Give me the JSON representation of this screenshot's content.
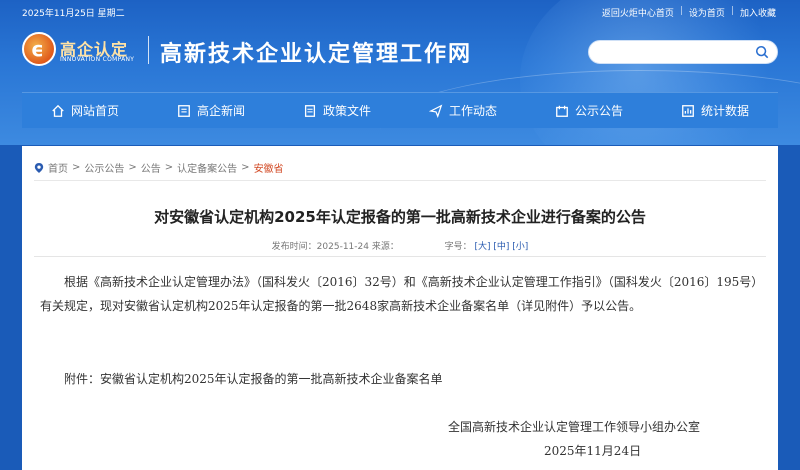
{
  "header": {
    "date": "2025年11月25日 星期二",
    "links": [
      "返回火炬中心首页",
      "设为首页",
      "加入收藏"
    ],
    "logo_cn": "高企认定",
    "logo_en": "INNOVATION COMPANY",
    "site_title": "高新技术企业认定管理工作网",
    "search_placeholder": ""
  },
  "nav": {
    "items": [
      {
        "label": "网站首页",
        "icon": "home-icon"
      },
      {
        "label": "高企新闻",
        "icon": "news-icon"
      },
      {
        "label": "政策文件",
        "icon": "document-icon"
      },
      {
        "label": "工作动态",
        "icon": "send-icon"
      },
      {
        "label": "公示公告",
        "icon": "notice-icon"
      },
      {
        "label": "统计数据",
        "icon": "chart-icon"
      }
    ]
  },
  "breadcrumb": {
    "items": [
      "首页",
      "公示公告",
      "公告",
      "认定备案公告"
    ],
    "current": "安徽省"
  },
  "article": {
    "title": "对安徽省认定机构2025年认定报备的第一批高新技术企业进行备案的公告",
    "meta_date": "发布时间：2025-11-24 来源：",
    "meta_size_label": "字号：",
    "size_options": [
      "[大]",
      "[中]",
      "[小]"
    ],
    "paragraph": "根据《高新技术企业认定管理办法》（国科发火〔2016〕32号）和《高新技术企业认定管理工作指引》（国科发火〔2016〕195号）有关规定，现对安徽省认定机构2025年认定报备的第一批2648家高新技术企业备案名单（详见附件）予以公告。",
    "attachment": "附件：安徽省认定机构2025年认定报备的第一批高新技术企业备案名单",
    "signer": "全国高新技术企业认定管理工作领导小组办公室",
    "sign_date": "2025年11月24日"
  }
}
